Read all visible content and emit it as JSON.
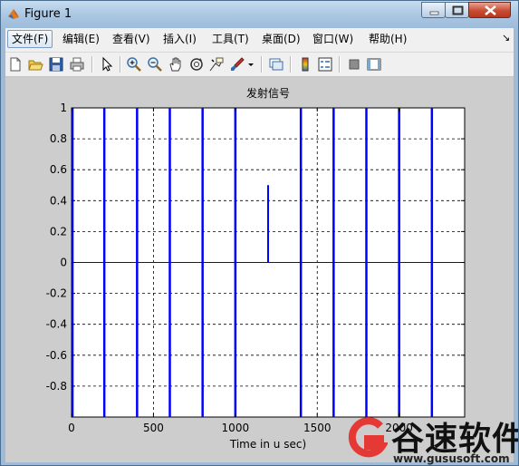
{
  "window": {
    "title": "Figure 1",
    "controls": [
      "minimize",
      "maximize",
      "close"
    ]
  },
  "menubar": {
    "items": [
      {
        "label": "文件(F)",
        "active": true
      },
      {
        "label": "编辑(E)"
      },
      {
        "label": "查看(V)"
      },
      {
        "label": "插入(I)"
      },
      {
        "label": "工具(T)"
      },
      {
        "label": "桌面(D)"
      },
      {
        "label": "窗口(W)"
      },
      {
        "label": "帮助(H)"
      }
    ]
  },
  "toolbar": {
    "buttons": [
      "new-figure-icon",
      "open-file-icon",
      "save-icon",
      "print-icon",
      "pointer-icon",
      "zoom-in-icon",
      "zoom-out-icon",
      "pan-hand-icon",
      "rotate-3d-icon",
      "data-cursor-icon",
      "brush-icon",
      "link-plot-icon",
      "colorbar-icon",
      "legend-icon",
      "hide-plot-tools-icon",
      "show-plot-tools-icon"
    ]
  },
  "chart_data": {
    "type": "line",
    "title": "发射信号",
    "xlabel": "Time in u sec)",
    "ylabel": "",
    "xlim": [
      0,
      2400
    ],
    "ylim": [
      -1,
      1
    ],
    "xticks": [
      "0",
      "500",
      "1000",
      "1500",
      "2000"
    ],
    "yticks": [
      "1",
      "0.8",
      "0.6",
      "0.4",
      "0.2",
      "0",
      "-0.2",
      "-0.4",
      "-0.6",
      "-0.8"
    ],
    "grid": true,
    "series": [
      {
        "color": "#0000ff",
        "baseline": 0,
        "pulses_full": [
          0,
          200,
          400,
          600,
          800,
          1000,
          1400,
          1600,
          1800,
          2000,
          2200
        ],
        "pulse_partial": {
          "x": 1200,
          "ymin": 0,
          "ymax": 0.5
        }
      }
    ]
  },
  "watermark": {
    "text": "谷速软件",
    "url": "www.gususoft.com"
  }
}
